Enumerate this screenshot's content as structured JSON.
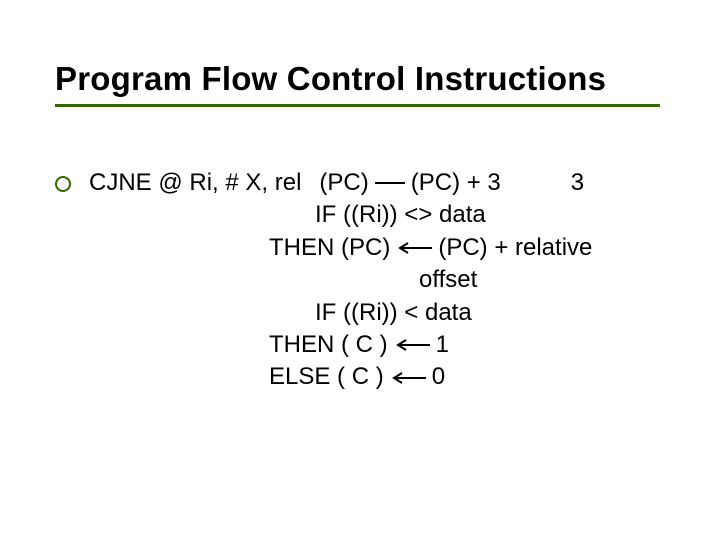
{
  "title": "Program Flow Control Instructions",
  "bullet": {
    "instr_prefix": "CJNE @ Ri, # X, rel",
    "pc_lhs": "(PC)",
    "pc_rhs": "(PC) + 3",
    "cycles": "3",
    "if_ri_ne": "IF ((Ri)) <> data",
    "then_pc_lhs": "THEN (PC)",
    "then_pc_rhs": "(PC) + relative",
    "offset_word": "offset",
    "if_ri_lt": "IF ((Ri)) < data",
    "then_c_lhs": "THEN ( C )",
    "then_c_rhs": "1",
    "else_c_lhs": "ELSE ( C )",
    "else_c_rhs": "0"
  }
}
